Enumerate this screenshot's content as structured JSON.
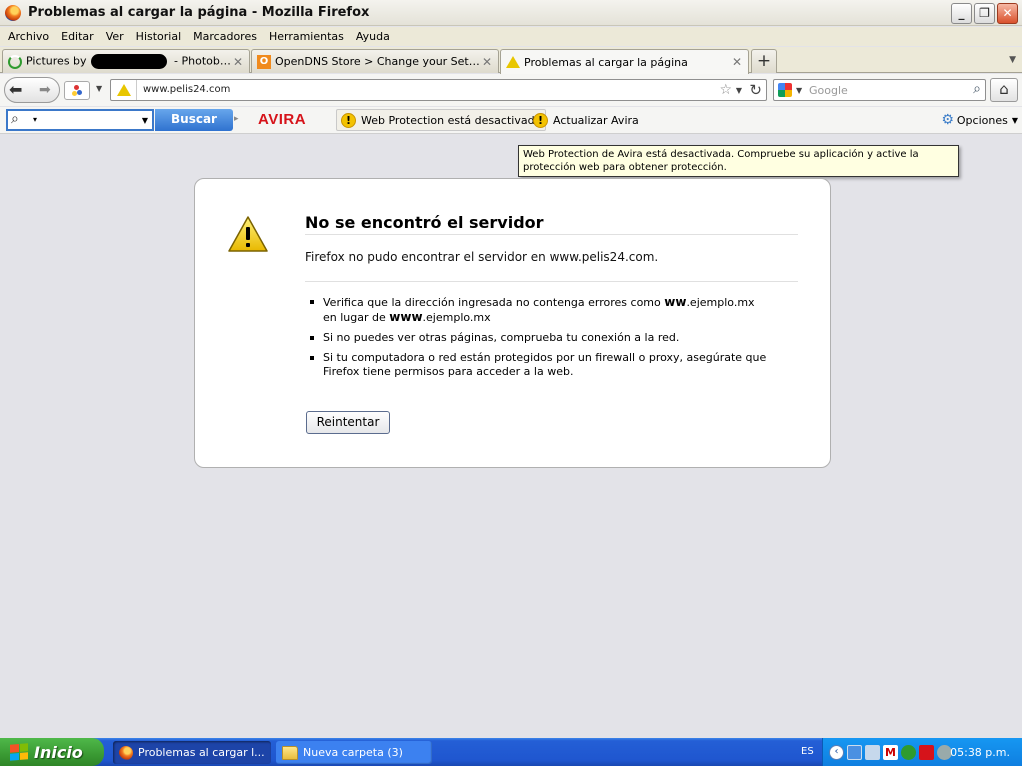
{
  "window": {
    "title": "Problemas al cargar la página - Mozilla Firefox",
    "minimize": "_",
    "restore": "❐",
    "close": "✕"
  },
  "menu": [
    "Archivo",
    "Editar",
    "Ver",
    "Historial",
    "Marcadores",
    "Herramientas",
    "Ayuda"
  ],
  "tabs": [
    {
      "label_start": "Pictures by",
      "label_end": " - Photobucket",
      "close": "✕"
    },
    {
      "label": "OpenDNS Store > Change your Settings ...",
      "icon_text": "O",
      "close": "✕"
    },
    {
      "label": "Problemas al cargar la página",
      "close": "✕"
    }
  ],
  "new_tab": "+",
  "navbar": {
    "url": "www.pelis24.com",
    "search_placeholder": "Google"
  },
  "avira": {
    "search_button": "Buscar",
    "logo": "AVIRA",
    "web_protection": "Web Protection está desactivada",
    "update": "Actualizar Avira",
    "options": "Opciones"
  },
  "tooltip": "Web Protection de Avira está desactivada. Compruebe su aplicación y active la protección web para obtener protección.",
  "error": {
    "title": "No se encontró el servidor",
    "description": "Firefox no pudo encontrar el servidor en www.pelis24.com.",
    "item1_a": "Verifica que la dirección ingresada no contenga errores como ",
    "item1_b1": "ww",
    "item1_c": ".ejemplo.mx",
    "item1_d": "en lugar de ",
    "item1_b2": "www",
    "item1_e": ".ejemplo.mx",
    "item2": "Si no puedes ver otras páginas, comprueba tu conexión a la red.",
    "item3": "Si tu computadora o red están protegidos por un firewall o proxy, asegúrate que Firefox tiene permisos para acceder a la web.",
    "retry": "Reintentar"
  },
  "taskbar": {
    "start": "Inicio",
    "items": [
      {
        "label": "Problemas al cargar l..."
      },
      {
        "label": "Nueva carpeta (3)"
      }
    ],
    "lang": "ES",
    "clock": "05:38 p.m."
  },
  "colors": {
    "avira_red": "#d6131a",
    "warning_yellow": "#f3c200",
    "tooltip_bg": "#ffffe1"
  }
}
